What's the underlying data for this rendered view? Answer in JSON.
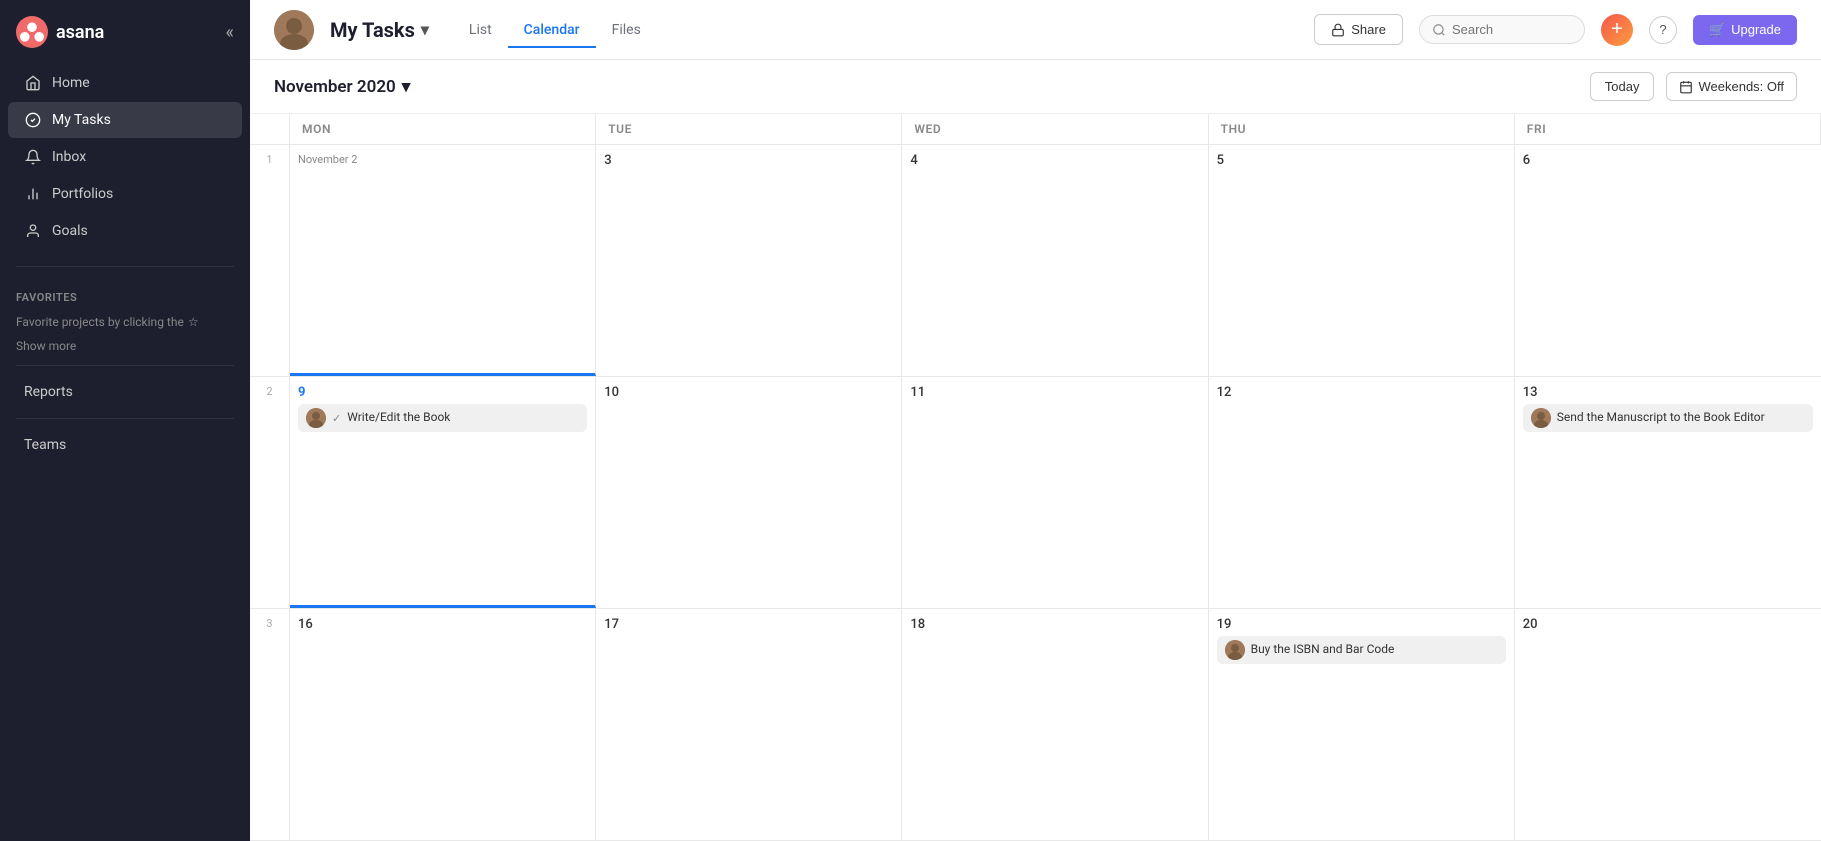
{
  "sidebar": {
    "logo": "asana",
    "collapse_icon": "«",
    "nav": [
      {
        "id": "home",
        "label": "Home",
        "icon": "home"
      },
      {
        "id": "my-tasks",
        "label": "My Tasks",
        "icon": "check-circle",
        "active": true
      },
      {
        "id": "inbox",
        "label": "Inbox",
        "icon": "bell"
      },
      {
        "id": "portfolios",
        "label": "Portfolios",
        "icon": "bar-chart"
      },
      {
        "id": "goals",
        "label": "Goals",
        "icon": "person"
      }
    ],
    "favorites_section": "Favorites",
    "favorites_hint": "Favorite projects by clicking the",
    "favorites_star": "★",
    "show_more": "Show more",
    "reports_label": "Reports",
    "teams_label": "Teams"
  },
  "topbar": {
    "title": "My Tasks",
    "chevron": "▾",
    "tabs": [
      {
        "id": "list",
        "label": "List",
        "active": false
      },
      {
        "id": "calendar",
        "label": "Calendar",
        "active": true
      },
      {
        "id": "files",
        "label": "Files",
        "active": false
      }
    ],
    "share_label": "Share",
    "search_placeholder": "Search",
    "add_icon": "+",
    "help_icon": "?",
    "upgrade_label": "Upgrade",
    "upgrade_icon": "🛒"
  },
  "calendar": {
    "month_title": "November 2020",
    "today_label": "Today",
    "weekends_label": "Weekends: Off",
    "header_days": [
      "Mon",
      "Tue",
      "Wed",
      "Thu",
      "Fri"
    ],
    "weeks": [
      {
        "week_num": "1",
        "days": [
          {
            "num": "",
            "label": "November 2",
            "is_label": true,
            "today": false,
            "tasks": []
          },
          {
            "num": "3",
            "label": "",
            "today": false,
            "tasks": []
          },
          {
            "num": "4",
            "label": "",
            "today": false,
            "tasks": []
          },
          {
            "num": "5",
            "label": "",
            "today": false,
            "tasks": []
          },
          {
            "num": "6",
            "label": "",
            "today": false,
            "tasks": []
          }
        ]
      },
      {
        "week_num": "2",
        "days": [
          {
            "num": "9",
            "label": "",
            "today": true,
            "tasks": [
              {
                "avatar": true,
                "check": "✓",
                "text": "Write/Edit the Book"
              }
            ]
          },
          {
            "num": "10",
            "label": "",
            "today": false,
            "tasks": []
          },
          {
            "num": "11",
            "label": "",
            "today": false,
            "tasks": []
          },
          {
            "num": "12",
            "label": "",
            "today": false,
            "tasks": []
          },
          {
            "num": "13",
            "label": "",
            "today": false,
            "tasks": [
              {
                "avatar": true,
                "check": "",
                "text": "Send the Manuscript to the Book Editor"
              }
            ]
          }
        ]
      },
      {
        "week_num": "3",
        "days": [
          {
            "num": "16",
            "label": "",
            "today": false,
            "tasks": []
          },
          {
            "num": "17",
            "label": "",
            "today": false,
            "tasks": []
          },
          {
            "num": "18",
            "label": "",
            "today": false,
            "tasks": []
          },
          {
            "num": "19",
            "label": "",
            "today": false,
            "tasks": [
              {
                "avatar": true,
                "check": "",
                "text": "Buy the ISBN and Bar Code"
              }
            ]
          },
          {
            "num": "20",
            "label": "",
            "today": false,
            "tasks": []
          }
        ]
      }
    ],
    "week_nums": [
      "1",
      "2",
      "3"
    ]
  }
}
